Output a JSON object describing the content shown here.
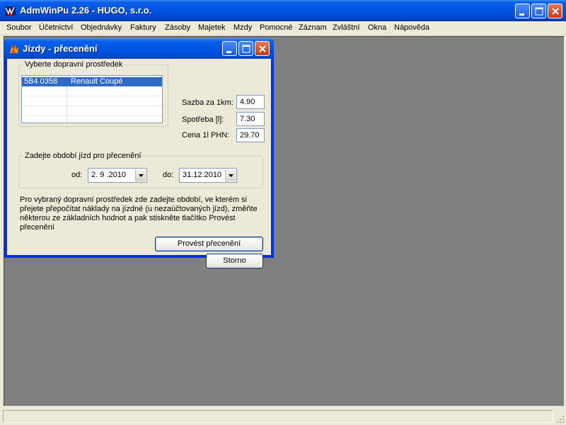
{
  "app": {
    "title": "AdmWinPu 2.26 - HUGO, s.r.o."
  },
  "menu": [
    "Soubor",
    "Účetnictví",
    "Objednávky",
    "Faktury",
    "Zásoby",
    "Majetek",
    "Mzdy",
    "Pomocné",
    "Záznam",
    "Zvláštní",
    "Okna",
    "Nápověda"
  ],
  "dialog": {
    "title": "Jízdy - přecenění",
    "vehicle_group_label": "Vyberte dopravní prostředek",
    "vehicles": [
      {
        "plate": "5B4 0358",
        "name": "Renault Coupé",
        "selected": true
      }
    ],
    "rate_label": "Sazba za 1km:",
    "rate_value": "4.90",
    "consumption_label": "Spotřeba [l]:",
    "consumption_value": "7.30",
    "fuel_price_label": "Cena 1l PHN:",
    "fuel_price_value": "29.70",
    "period_group_label": "Zadejte období jízd pro přecenění",
    "from_label": "od:",
    "from_value": "2. 9 .2010",
    "to_label": "do:",
    "to_value": "31.12.2010",
    "description": "Pro vybraný dopravní prostředek zde zadejte období, ve kterém si přejete přepočítat náklady na jízdné (u nezaúčtovaných jízd), změňte některou ze základních hodnot a pak stiskněte tlačítko Provést přecenění",
    "execute_button": "Provést přecenění",
    "cancel_button": "Storno"
  },
  "colors": {
    "titlebar": "#0054e3",
    "selection": "#316ac5",
    "mdi_background": "#808080",
    "dialog_face": "#ece9d8"
  }
}
